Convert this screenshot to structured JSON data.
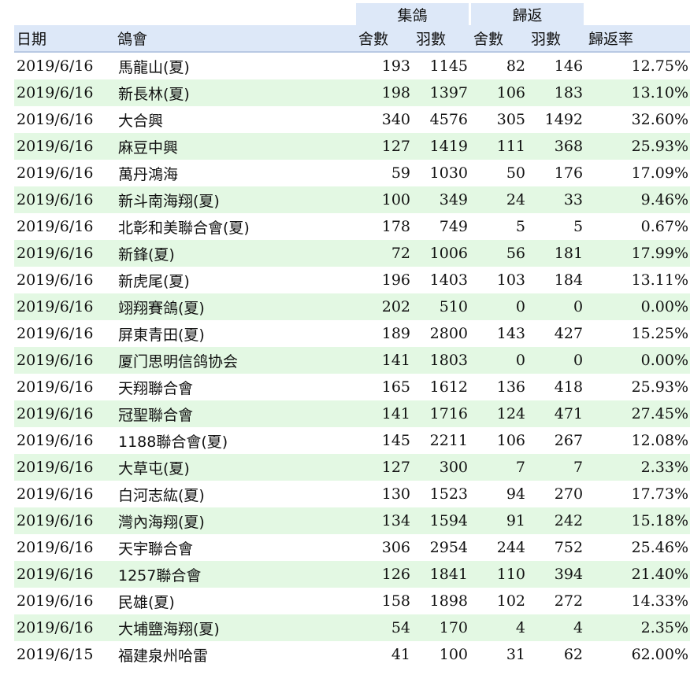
{
  "header": {
    "group_release": "集鴿",
    "group_return": "歸返",
    "date": "日期",
    "club": "鴿會",
    "release_lofts": "舍數",
    "release_birds": "羽數",
    "return_lofts": "舍數",
    "return_birds": "羽數",
    "return_rate": "歸返率"
  },
  "rows": [
    {
      "date": "2019/6/16",
      "club": "馬龍山(夏)",
      "rel_lofts": "193",
      "rel_birds": "1145",
      "ret_lofts": "82",
      "ret_birds": "146",
      "rate": "12.75%"
    },
    {
      "date": "2019/6/16",
      "club": "新長林(夏)",
      "rel_lofts": "198",
      "rel_birds": "1397",
      "ret_lofts": "106",
      "ret_birds": "183",
      "rate": "13.10%"
    },
    {
      "date": "2019/6/16",
      "club": "大合興",
      "rel_lofts": "340",
      "rel_birds": "4576",
      "ret_lofts": "305",
      "ret_birds": "1492",
      "rate": "32.60%"
    },
    {
      "date": "2019/6/16",
      "club": "麻豆中興",
      "rel_lofts": "127",
      "rel_birds": "1419",
      "ret_lofts": "111",
      "ret_birds": "368",
      "rate": "25.93%"
    },
    {
      "date": "2019/6/16",
      "club": "萬丹鴻海",
      "rel_lofts": "59",
      "rel_birds": "1030",
      "ret_lofts": "50",
      "ret_birds": "176",
      "rate": "17.09%"
    },
    {
      "date": "2019/6/16",
      "club": "新斗南海翔(夏)",
      "rel_lofts": "100",
      "rel_birds": "349",
      "ret_lofts": "24",
      "ret_birds": "33",
      "rate": "9.46%"
    },
    {
      "date": "2019/6/16",
      "club": "北彰和美聯合會(夏)",
      "rel_lofts": "178",
      "rel_birds": "749",
      "ret_lofts": "5",
      "ret_birds": "5",
      "rate": "0.67%"
    },
    {
      "date": "2019/6/16",
      "club": "新鋒(夏)",
      "rel_lofts": "72",
      "rel_birds": "1006",
      "ret_lofts": "56",
      "ret_birds": "181",
      "rate": "17.99%"
    },
    {
      "date": "2019/6/16",
      "club": "新虎尾(夏)",
      "rel_lofts": "196",
      "rel_birds": "1403",
      "ret_lofts": "103",
      "ret_birds": "184",
      "rate": "13.11%"
    },
    {
      "date": "2019/6/16",
      "club": "翊翔賽鴿(夏)",
      "rel_lofts": "202",
      "rel_birds": "510",
      "ret_lofts": "0",
      "ret_birds": "0",
      "rate": "0.00%"
    },
    {
      "date": "2019/6/16",
      "club": "屏東青田(夏)",
      "rel_lofts": "189",
      "rel_birds": "2800",
      "ret_lofts": "143",
      "ret_birds": "427",
      "rate": "15.25%"
    },
    {
      "date": "2019/6/16",
      "club": "厦门思明信鸽协会",
      "rel_lofts": "141",
      "rel_birds": "1803",
      "ret_lofts": "0",
      "ret_birds": "0",
      "rate": "0.00%"
    },
    {
      "date": "2019/6/16",
      "club": "天翔聯合會",
      "rel_lofts": "165",
      "rel_birds": "1612",
      "ret_lofts": "136",
      "ret_birds": "418",
      "rate": "25.93%"
    },
    {
      "date": "2019/6/16",
      "club": "冠聖聯合會",
      "rel_lofts": "141",
      "rel_birds": "1716",
      "ret_lofts": "124",
      "ret_birds": "471",
      "rate": "27.45%"
    },
    {
      "date": "2019/6/16",
      "club": "1188聯合會(夏)",
      "rel_lofts": "145",
      "rel_birds": "2211",
      "ret_lofts": "106",
      "ret_birds": "267",
      "rate": "12.08%"
    },
    {
      "date": "2019/6/16",
      "club": "大草屯(夏)",
      "rel_lofts": "127",
      "rel_birds": "300",
      "ret_lofts": "7",
      "ret_birds": "7",
      "rate": "2.33%"
    },
    {
      "date": "2019/6/16",
      "club": "白河志紘(夏)",
      "rel_lofts": "130",
      "rel_birds": "1523",
      "ret_lofts": "94",
      "ret_birds": "270",
      "rate": "17.73%"
    },
    {
      "date": "2019/6/16",
      "club": "灣內海翔(夏)",
      "rel_lofts": "134",
      "rel_birds": "1594",
      "ret_lofts": "91",
      "ret_birds": "242",
      "rate": "15.18%"
    },
    {
      "date": "2019/6/16",
      "club": "天宇聯合會",
      "rel_lofts": "306",
      "rel_birds": "2954",
      "ret_lofts": "244",
      "ret_birds": "752",
      "rate": "25.46%"
    },
    {
      "date": "2019/6/16",
      "club": "1257聯合會",
      "rel_lofts": "126",
      "rel_birds": "1841",
      "ret_lofts": "110",
      "ret_birds": "394",
      "rate": "21.40%"
    },
    {
      "date": "2019/6/16",
      "club": "民雄(夏)",
      "rel_lofts": "158",
      "rel_birds": "1898",
      "ret_lofts": "102",
      "ret_birds": "272",
      "rate": "14.33%"
    },
    {
      "date": "2019/6/16",
      "club": "大埔鹽海翔(夏)",
      "rel_lofts": "54",
      "rel_birds": "170",
      "ret_lofts": "4",
      "ret_birds": "4",
      "rate": "2.35%"
    },
    {
      "date": "2019/6/15",
      "club": "福建泉州哈雷",
      "rel_lofts": "41",
      "rel_birds": "100",
      "ret_lofts": "31",
      "ret_birds": "62",
      "rate": "62.00%"
    }
  ]
}
